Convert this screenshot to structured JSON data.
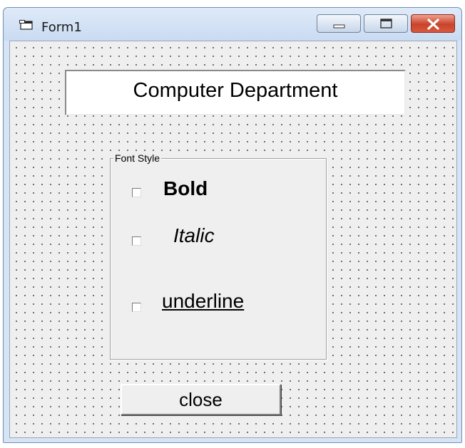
{
  "window": {
    "title": "Form1",
    "icon": "form-window-icon",
    "controls": [
      "minimize-icon",
      "maximize-icon",
      "close-icon"
    ],
    "accent_colors": {
      "titlebar": "#d6e4f5",
      "close": "#c8432c"
    }
  },
  "form": {
    "label_text": "Computer Department",
    "frame_caption": "Font Style",
    "checkboxes": [
      {
        "label": "Bold",
        "checked": false
      },
      {
        "label": "Italic",
        "checked": false
      },
      {
        "label": "underline",
        "checked": false
      }
    ],
    "close_label": "close"
  }
}
